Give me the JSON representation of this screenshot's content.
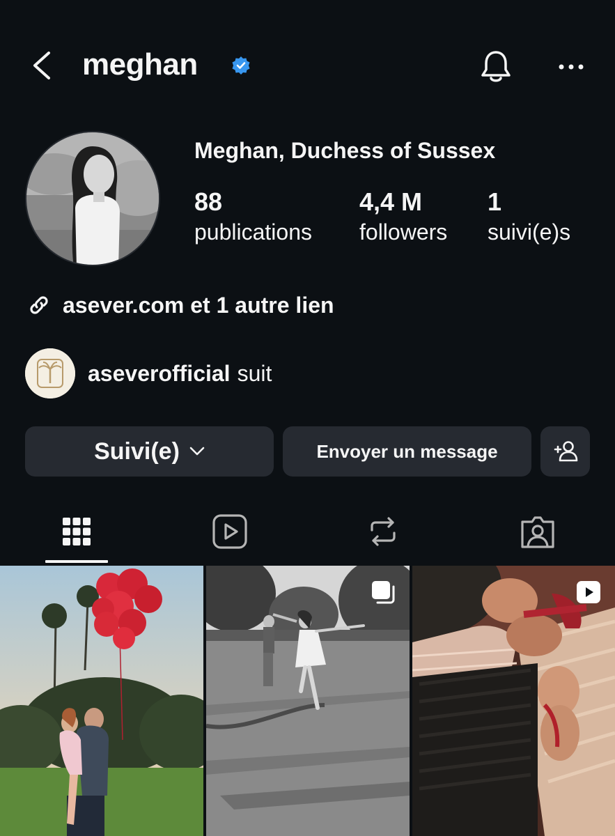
{
  "header": {
    "username": "meghan",
    "back_icon": "chevron-left-icon",
    "verified_icon": "verified-badge-icon",
    "bell_icon": "bell-icon",
    "more_icon": "more-horizontal-icon"
  },
  "profile": {
    "full_name": "Meghan, Duchess of Sussex",
    "stats": [
      {
        "value": "88",
        "label": "publications"
      },
      {
        "value": "4,4 M",
        "label": "followers"
      },
      {
        "value": "1",
        "label": "suivi(e)s"
      }
    ],
    "link_text": "asever.com et 1 autre lien",
    "link_icon": "link-icon",
    "followed_by": {
      "name": "aseverofficial",
      "suffix": "suit"
    }
  },
  "actions": {
    "following_label": "Suivi(e)",
    "message_label": "Envoyer un message",
    "add_user_icon": "add-user-icon"
  },
  "tabs": [
    {
      "icon": "grid-icon",
      "active": true
    },
    {
      "icon": "reels-icon",
      "active": false
    },
    {
      "icon": "reposts-icon",
      "active": false
    },
    {
      "icon": "tagged-icon",
      "active": false
    }
  ],
  "grid": [
    {
      "badge": ""
    },
    {
      "badge": "carousel-icon"
    },
    {
      "badge": "reel-icon"
    }
  ],
  "colors": {
    "background": "#0c1014",
    "button": "#262a31",
    "text": "#f5f5f5",
    "verified": "#3897f0"
  }
}
